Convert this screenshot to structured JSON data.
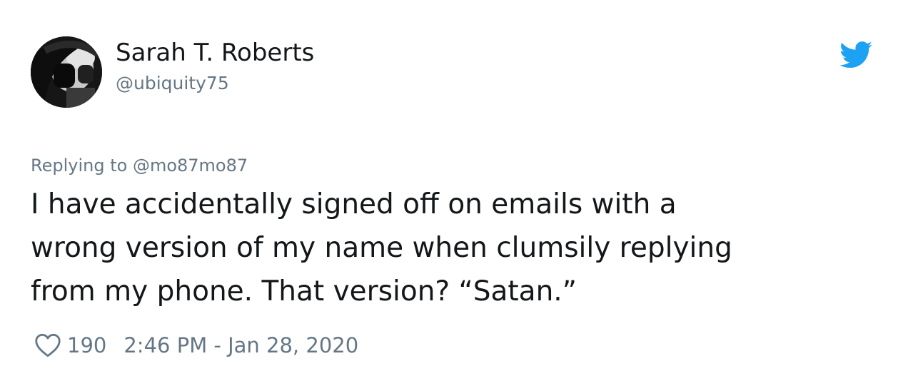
{
  "author": {
    "display_name": "Sarah T. Roberts",
    "handle": "@ubiquity75"
  },
  "icons": {
    "avatar": "profile-photo",
    "brand": "twitter-bird-icon",
    "like": "heart-outline-icon"
  },
  "colors": {
    "brand_blue": "#1da1f2",
    "text": "#14171a",
    "muted": "#657786"
  },
  "reply": {
    "prefix": "Replying to",
    "handle": "@mo87mo87"
  },
  "tweet": {
    "lines": [
      "I have accidentally signed off on emails with a",
      "wrong version of my name when clumsily replying",
      "from my phone. That version? “Satan.”"
    ],
    "likes": "190",
    "timestamp": "2:46 PM - Jan 28, 2020"
  }
}
